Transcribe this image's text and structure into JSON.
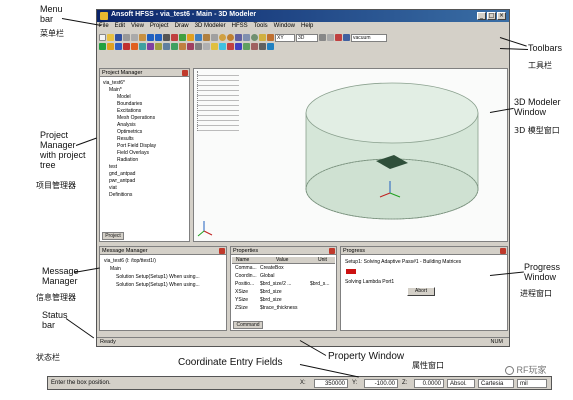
{
  "window": {
    "title": "Ansoft HFSS - via_test6 - Main - 3D Modeler",
    "min": "_",
    "max": "□",
    "close": "×"
  },
  "menu": [
    "File",
    "Edit",
    "View",
    "Project",
    "Draw",
    "3D Modeler",
    "HFSS",
    "Tools",
    "Window",
    "Help"
  ],
  "toolbar": {
    "dropdown1": "XY",
    "dropdown2": "3D",
    "dropdown3": "vacuum"
  },
  "project_manager": {
    "title": "Project Manager",
    "items": [
      "via_test6*",
      "Main*",
      "Model",
      "Boundaries",
      "Excitations",
      "Mesh Operations",
      "Analysis",
      "Optimetrics",
      "Results",
      "Port Field Display",
      "Field Overlays",
      "Radiation",
      "test",
      "gnd_antpad",
      "pwr_antpad",
      "viat",
      "Definitions"
    ],
    "tab": "Project"
  },
  "message_manager": {
    "title": "Message Manager",
    "lines": [
      "via_test6 (l: /top/ttest1/)",
      "Main",
      "Solution Setup(Setup1) When using...",
      "Solution Setup(Setup1) When using..."
    ]
  },
  "properties": {
    "title": "Properties",
    "headers": [
      "Name",
      "Value",
      "Unit"
    ],
    "rows": [
      [
        "Comma...",
        "CreateBox",
        ""
      ],
      [
        "Coordin...",
        "Global",
        ""
      ],
      [
        "Positio...",
        "$brd_size/2 ...",
        "$brd_s..."
      ],
      [
        "XSize",
        "$brd_size",
        ""
      ],
      [
        "YSize",
        "$brd_size",
        ""
      ],
      [
        "ZSize",
        "$trace_thickness",
        ""
      ]
    ],
    "tab": "Command"
  },
  "progress": {
    "title": "Progress",
    "line1": "Setup1: Solving Adaptive Pass#1 - Building Matrices",
    "line2": "Solving Lambda Port1",
    "abort": "Abort"
  },
  "status": {
    "left": "Ready",
    "right": "NUM"
  },
  "coord_entry": {
    "prompt": "Enter the box position.",
    "x_label": "X:",
    "x_value": "350000",
    "y_label": "Y:",
    "y_value": "-100.00",
    "z_label": "Z:",
    "z_value": "0.0000",
    "mode": "Absol.",
    "system": "Cartesia",
    "unit": "mil"
  },
  "annotations": {
    "menu_bar": "Menu\nbar",
    "menu_bar_zh": "菜单栏",
    "toolbars": "Toolbars",
    "toolbars_zh": "工具栏",
    "modeler_window": "3D Modeler\nWindow",
    "modeler_window_zh": "3D 模型窗口",
    "project_manager": "Project\nManager\nwith project\ntree",
    "project_manager_zh": "项目管理器",
    "message_manager": "Message\nManager",
    "message_manager_zh": "信息管理器",
    "progress_window": "Progress\nWindow",
    "progress_window_zh": "进程窗口",
    "status_bar": "Status\nbar",
    "status_bar_zh": "状态栏",
    "coordinate_fields": "Coordinate Entry Fields",
    "property_window": "Property Window",
    "property_window_zh": "属性窗口",
    "watermark": "RF玩家"
  },
  "colors": {
    "title_bar": "#0a246a",
    "window_bg": "#d4d0c8",
    "cylinder": "#d8e8dc",
    "via_pad": "#2f4f3a",
    "abort_red": "#cc1111"
  }
}
